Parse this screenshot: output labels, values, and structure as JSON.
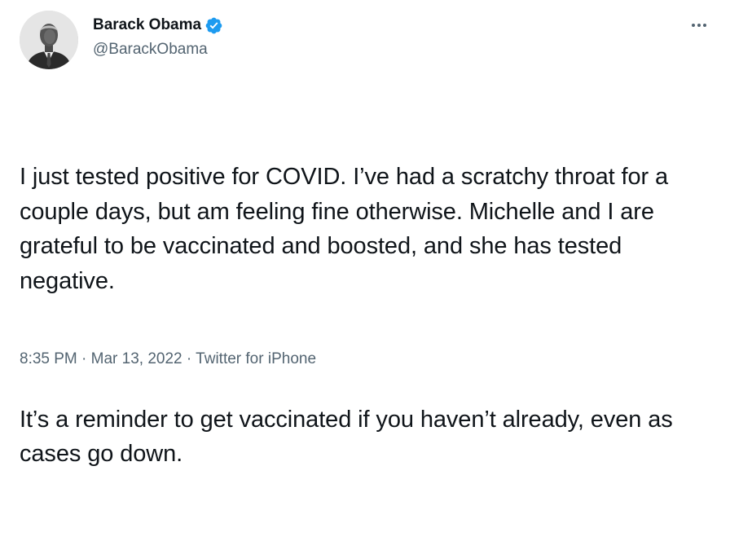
{
  "author": {
    "display_name": "Barack Obama",
    "handle": "@BarackObama",
    "verified": true,
    "verified_color": "#1d9bf0"
  },
  "more_icon": "more-horizontal-icon",
  "tweet": {
    "paragraph_1": "I just tested positive for COVID. I’ve had a scratchy throat for a couple days, but am feeling fine otherwise. Michelle and I are grateful to be vaccinated and boosted, and she has tested negative.",
    "paragraph_2": "It’s a reminder to get vaccinated if you haven’t already, even as cases go down."
  },
  "meta": {
    "time": "8:35 PM",
    "separator": "·",
    "date": "Mar 13, 2022",
    "source": "Twitter for iPhone"
  },
  "colors": {
    "text": "#0f1419",
    "secondary": "#536471",
    "background": "#ffffff"
  }
}
